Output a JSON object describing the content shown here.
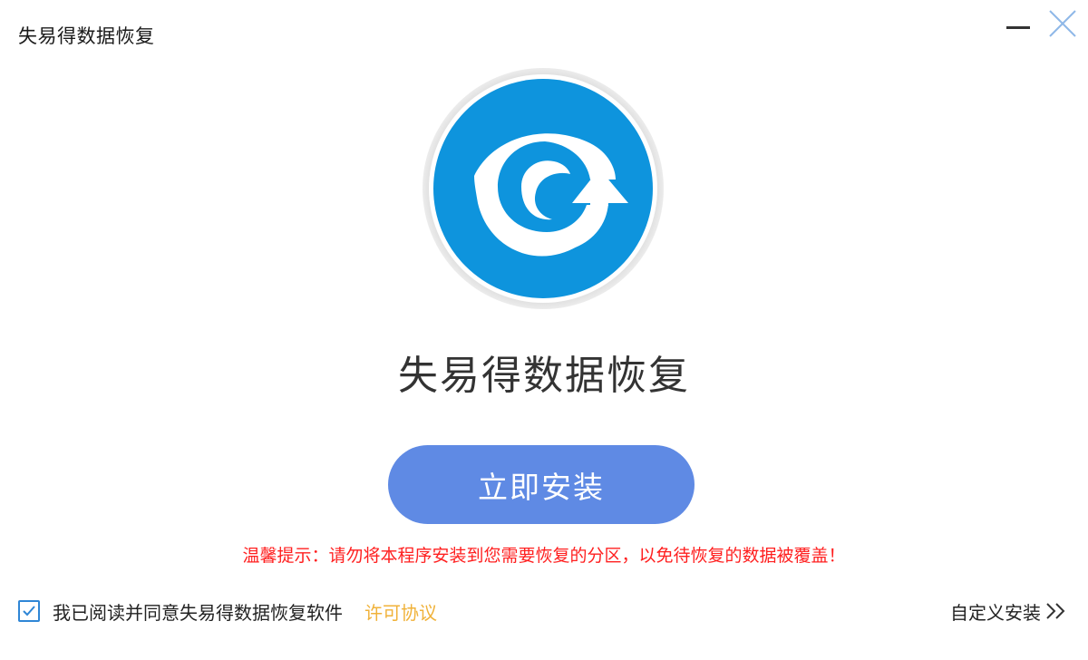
{
  "window": {
    "title": "失易得数据恢复"
  },
  "icons": {
    "minimize": "minimize-icon",
    "close": "close-icon",
    "logo": "recovery-logo-icon",
    "checkbox": "checkmark-icon",
    "custom": "double-chevron-right-icon"
  },
  "main": {
    "product_name": "失易得数据恢复",
    "install_button_label": "立即安装",
    "warning": "温馨提示：请勿将本程序安装到您需要恢复的分区，以免待恢复的数据被覆盖！"
  },
  "footer": {
    "agreement_checked": true,
    "agreement_text": "我已阅读并同意失易得数据恢复软件",
    "license_link": "许可协议",
    "custom_install": "自定义安装"
  },
  "colors": {
    "logo_blue": "#0e94dd",
    "install_button": "#5f8ae4",
    "warning_red": "#ff1f1f",
    "link_yellow": "#f0b23a",
    "checkbox_blue": "#2f86d6"
  }
}
